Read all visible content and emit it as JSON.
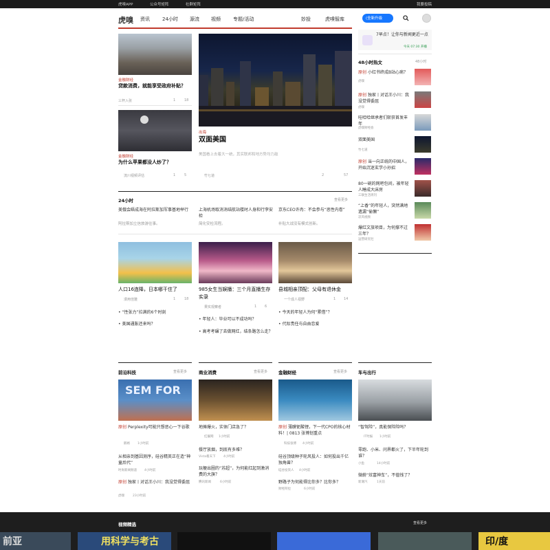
{
  "topbar": {
    "app": "虎嗅APP",
    "gzh": "公众号矩阵",
    "community": "社群矩阵",
    "contribute": "我要投稿"
  },
  "nav": {
    "logo": "虎嗅",
    "items": [
      "资讯",
      "24小时",
      "源流",
      "视频",
      "专题/活动"
    ],
    "right_items": [
      "妙投",
      "虎嗅智库"
    ],
    "upgrade": "(全新升级",
    "icons": [
      "search-icon",
      "user-avatar"
    ]
  },
  "lead": {
    "left1": {
      "tag": "金融财经",
      "title": "贷款消费，就能享受政府补贴？",
      "author": "三杯入张",
      "comments": "1",
      "likes": "18"
    },
    "left2": {
      "tag": "金融财经",
      "title": "为什么苹果都没人炒了？",
      "author": "流川视频评估",
      "comments": "1",
      "likes": "5"
    },
    "main": {
      "tag": "出海",
      "title": "双面美国",
      "summary": "美国看上去着大一统，其实联邦和地方势均力敌",
      "author": "竹七道",
      "comments": "2",
      "likes": "57"
    }
  },
  "h24": {
    "title": "24小时",
    "more": "查看更多",
    "items": [
      {
        "title": "美俄会晤成海在阿拉斯加军事基地举行",
        "sub": "阿拉斯加立信旅游往事。"
      },
      {
        "title": "上海机场取消消结航站楼时人身和行李安检",
        "sub": "简化安检流程。"
      },
      {
        "title": "京东CEO许冉：不会参与“恶性内卷”",
        "sub": "补贴大战没有模式创新。"
      }
    ]
  },
  "cards": [
    {
      "title": "人口16连降，日本哪干住了",
      "author": "漫用佳雅",
      "comments": "1",
      "likes": "18",
      "bullets": [
        "“性张力”拉满的6个时刻",
        "美国通胀还来吗？"
      ]
    },
    {
      "title": "985女生当娱播：三个月直播生存实录",
      "author": "果实观察者",
      "comments": "1",
      "likes": "6",
      "bullets": [
        "年轻人：毕业可以不成功吗？",
        "高考考碾了去做网红，结条路怎么走？"
      ]
    },
    {
      "title": "县城相亲顶配：父母有退休金",
      "author": "一个成人视野",
      "comments": "1",
      "likes": "14",
      "bullets": [
        "今天的年轻人为何“累借”？",
        "代际责任与自由恋爱"
      ]
    }
  ],
  "sidebar": {
    "ad_text": "7早点！让你与新闻更近一点",
    "ad_meta": "今天 07:30 开播",
    "hot_title": "48小时热文",
    "hot_more": "48小时",
    "items": [
      {
        "tag": "原创",
        "title": "小红书终成B站心病？",
        "source": "虎嗅"
      },
      {
        "tag": "原创",
        "title": "独家丨对话王小川：我没觉得委屈",
        "source": "虎嗅"
      },
      {
        "tag": "",
        "title": "哇哈哈继承者们斩获首发丰年",
        "source": "虎嗅财经会"
      },
      {
        "tag": "",
        "title": "双面美国",
        "source": "竹七道"
      },
      {
        "tag": "原创",
        "title": "当一向正统的中国人，开始沉迷玄学小孙招",
        "source": "虎嗅"
      },
      {
        "tag": "",
        "title": "80一碗的网吧包间，被年轻人睡成大床房",
        "source": "三联生活周刊"
      },
      {
        "tag": "",
        "title": "“上香”的年轻人，突然满地遗漏“偷懒”",
        "source": "凉风视频"
      },
      {
        "tag": "",
        "title": "爆红文旅项目，为何撑不过三年？",
        "source": "运营研究社"
      }
    ]
  },
  "sections": [
    {
      "title": "前沿科技",
      "more": "查看更多",
      "lead_tag": "原创",
      "lead_title": "Perplexity可能只想恶心一下谷歌",
      "author": "鹅格",
      "time": "1小时前",
      "items": [
        {
          "title": "从相亲到基因测序，硅谷精英正在造“神童后代”",
          "source": "时尚新闻频道",
          "time": "4小时前"
        },
        {
          "tag": "原创",
          "title": "独家丨对话王小川：我没觉得委屈",
          "source": "虎嗅",
          "time": "23小时前"
        }
      ]
    },
    {
      "title": "商业消费",
      "more": "查看更多",
      "lead_tag": "",
      "lead_title": "地摊爆火，实体门店急了？",
      "author": "红餐网",
      "time": "1小时前",
      "items": [
        {
          "title": "餐厅放烟，到底有多难？",
          "source": "Vista看天下",
          "time": "4小时前"
        },
        {
          "title": "玩梗出圈的“苏超”，为何能红起到激消费的大旗？",
          "source": "腾讯新闻",
          "time": "6小时前"
        }
      ]
    },
    {
      "title": "金融财经",
      "more": "查看更多",
      "lead_tag": "原创",
      "lead_title": "薄膜铌酸锂，下一代CPO的核心材料！| 0813 张博划重点",
      "author": "科技张博",
      "time": "4小时前",
      "items": [
        {
          "title": "硅谷顶级种子轮风投人：如何投出千亿独角兽？",
          "source": "硅谷投资人",
          "time": "4小时前"
        },
        {
          "title": "野路子为何能得比你多？比你多？",
          "source": "财经阿拉",
          "time": "6小时前"
        }
      ]
    },
    {
      "title": "车与出行",
      "more": "",
      "lead_tag": "",
      "lead_title": "“智驾险”，真能保险险吗？",
      "author": "IT时报",
      "time": "1小时前",
      "items": [
        {
          "title": "零跑、小米、问界都火了，下半年轮到谁？",
          "source": "小鱼",
          "time": "14小时前"
        },
        {
          "title": "微蔚“炫富神车”，不值钱了？",
          "source": "新潮汽",
          "time": "1天前"
        }
      ]
    }
  ],
  "video": {
    "title": "视频精选",
    "more": "查看更多",
    "tiles": [
      "前亚",
      "用科学与考古",
      "",
      "",
      "",
      "印/度"
    ]
  }
}
